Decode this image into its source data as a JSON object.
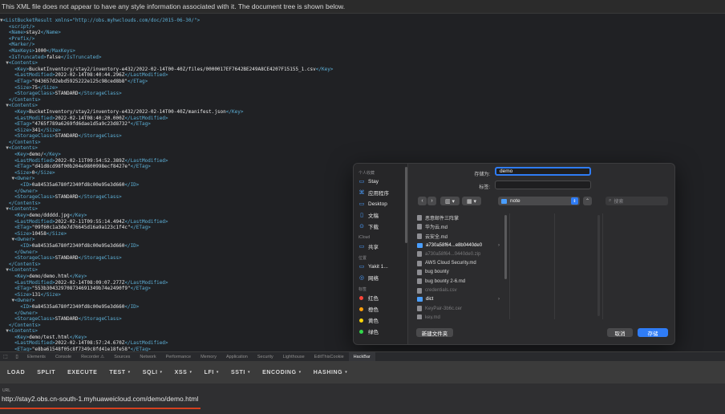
{
  "xml_viewer": {
    "notice": "This XML file does not appear to have any style information associated with it. The document tree is shown below.",
    "lines": [
      {
        "i": 0,
        "a": "▼",
        "t": "<ListBucketResult xmlns=\"http://obs.myhwclouds.com/doc/2015-06-30/\">",
        "k": "tag"
      },
      {
        "i": 1,
        "t": "<script/>",
        "k": "tag"
      },
      {
        "i": 1,
        "t": "<Name>stay2</Name>",
        "k": "mixed"
      },
      {
        "i": 1,
        "t": "<Prefix/>",
        "k": "tag"
      },
      {
        "i": 1,
        "t": "<Marker/>",
        "k": "tag"
      },
      {
        "i": 1,
        "t": "<MaxKeys>1000</MaxKeys>",
        "k": "mixed"
      },
      {
        "i": 1,
        "t": "<IsTruncated>false</IsTruncated>",
        "k": "mixed"
      },
      {
        "i": 1,
        "a": "▼",
        "t": "<Contents>",
        "k": "tag"
      },
      {
        "i": 2,
        "t": "<Key>BucketInventory/stay2/inventory-e432/2022-02-14T00-40Z/files/0000017EF7642BE249A8CE4207F15155_1.csv</Key>",
        "k": "mixed"
      },
      {
        "i": 2,
        "t": "<LastModified>2022-02-14T08:40:44.296Z</LastModified>",
        "k": "mixed"
      },
      {
        "i": 2,
        "t": "<ETag>\"043657d2ebd5925222e125c98ced8b8\"</ETag>",
        "k": "mixed"
      },
      {
        "i": 2,
        "t": "<Size>75</Size>",
        "k": "mixed"
      },
      {
        "i": 2,
        "t": "<StorageClass>STANDARD</StorageClass>",
        "k": "mixed"
      },
      {
        "i": 1,
        "t": "</Contents>",
        "k": "tag"
      },
      {
        "i": 1,
        "a": "▼",
        "t": "<Contents>",
        "k": "tag"
      },
      {
        "i": 2,
        "t": "<Key>BucketInventory/stay2/inventory-e432/2022-02-14T00-40Z/manifest.json</Key>",
        "k": "mixed"
      },
      {
        "i": 2,
        "t": "<LastModified>2022-02-14T08:40:20.000Z</LastModified>",
        "k": "mixed"
      },
      {
        "i": 2,
        "t": "<ETag>\"4765f789a6269fd6dae1d5a9c23d8732\"</ETag>",
        "k": "mixed"
      },
      {
        "i": 2,
        "t": "<Size>341</Size>",
        "k": "mixed"
      },
      {
        "i": 2,
        "t": "<StorageClass>STANDARD</StorageClass>",
        "k": "mixed"
      },
      {
        "i": 1,
        "t": "</Contents>",
        "k": "tag"
      },
      {
        "i": 1,
        "a": "▼",
        "t": "<Contents>",
        "k": "tag"
      },
      {
        "i": 2,
        "t": "<Key>demo/</Key>",
        "k": "mixed"
      },
      {
        "i": 2,
        "t": "<LastModified>2022-02-11T09:54:52.389Z</LastModified>",
        "k": "mixed"
      },
      {
        "i": 2,
        "t": "<ETag>\"d41d8cd98f00b204e9800998ecf8427e\"</ETag>",
        "k": "mixed"
      },
      {
        "i": 2,
        "t": "<Size>0</Size>",
        "k": "mixed"
      },
      {
        "i": 2,
        "a": "▼",
        "t": "<Owner>",
        "k": "tag"
      },
      {
        "i": 3,
        "t": "<ID>0a84535a6780f2340fd8c00e95e3d660</ID>",
        "k": "mixed"
      },
      {
        "i": 2,
        "t": "</Owner>",
        "k": "tag"
      },
      {
        "i": 2,
        "t": "<StorageClass>STANDARD</StorageClass>",
        "k": "mixed"
      },
      {
        "i": 1,
        "t": "</Contents>",
        "k": "tag"
      },
      {
        "i": 1,
        "a": "▼",
        "t": "<Contents>",
        "k": "tag"
      },
      {
        "i": 2,
        "t": "<Key>demo/ddddd.jpg</Key>",
        "k": "mixed"
      },
      {
        "i": 2,
        "t": "<LastModified>2022-02-11T09:55:14.494Z</LastModified>",
        "k": "mixed"
      },
      {
        "i": 2,
        "t": "<ETag>\"09f60c1a3de7d76645d16a9a123c1f4c\"</ETag>",
        "k": "mixed"
      },
      {
        "i": 2,
        "t": "<Size>10458</Size>",
        "k": "mixed"
      },
      {
        "i": 2,
        "a": "▼",
        "t": "<Owner>",
        "k": "tag"
      },
      {
        "i": 3,
        "t": "<ID>0a84535a6780f2340fd8c00e95e3d660</ID>",
        "k": "mixed"
      },
      {
        "i": 2,
        "t": "</Owner>",
        "k": "tag"
      },
      {
        "i": 2,
        "t": "<StorageClass>STANDARD</StorageClass>",
        "k": "mixed"
      },
      {
        "i": 1,
        "t": "</Contents>",
        "k": "tag"
      },
      {
        "i": 1,
        "a": "▼",
        "t": "<Contents>",
        "k": "tag"
      },
      {
        "i": 2,
        "t": "<Key>demo/demo.html</Key>",
        "k": "mixed"
      },
      {
        "i": 2,
        "t": "<LastModified>2022-02-14T08:09:07.277Z</LastModified>",
        "k": "mixed"
      },
      {
        "i": 2,
        "t": "<ETag>\"553b304329708734691349b74e2490f9\"</ETag>",
        "k": "mixed"
      },
      {
        "i": 2,
        "t": "<Size>131</Size>",
        "k": "mixed"
      },
      {
        "i": 2,
        "a": "▼",
        "t": "<Owner>",
        "k": "tag"
      },
      {
        "i": 3,
        "t": "<ID>0a84535a6780f2340fd8c00e95e3d660</ID>",
        "k": "mixed"
      },
      {
        "i": 2,
        "t": "</Owner>",
        "k": "tag"
      },
      {
        "i": 2,
        "t": "<StorageClass>STANDARD</StorageClass>",
        "k": "mixed"
      },
      {
        "i": 1,
        "t": "</Contents>",
        "k": "tag"
      },
      {
        "i": 1,
        "a": "▼",
        "t": "<Contents>",
        "k": "tag"
      },
      {
        "i": 2,
        "t": "<Key>demo/test.html</Key>",
        "k": "mixed"
      },
      {
        "i": 2,
        "t": "<LastModified>2022-02-14T08:57:24.670Z</LastModified>",
        "k": "mixed"
      },
      {
        "i": 2,
        "t": "<ETag>\"e8ba61548f05c8f7349c8fd41e18fe58\"</ETag>",
        "k": "mixed"
      }
    ]
  },
  "save_dialog": {
    "save_as_label": "存储为:",
    "save_as_value": "demo",
    "tags_label": "标签:",
    "tags_value": "",
    "location": "note",
    "search_placeholder": "搜索",
    "sidebar": {
      "favorites_header": "个人收藏",
      "favorites": [
        {
          "label": "Stay",
          "icon": "folder-icon"
        },
        {
          "label": "应用程序",
          "icon": "applications-icon"
        },
        {
          "label": "Desktop",
          "icon": "desktop-icon"
        },
        {
          "label": "文稿",
          "icon": "document-icon"
        },
        {
          "label": "下载",
          "icon": "download-icon"
        }
      ],
      "icloud_header": "iCloud",
      "icloud": [
        {
          "label": "共享",
          "icon": "shared-folder-icon"
        }
      ],
      "locations_header": "位置",
      "locations": [
        {
          "label": "Yakit 1...",
          "icon": "disk-icon"
        },
        {
          "label": "网络",
          "icon": "network-icon"
        }
      ],
      "tags_header": "标签",
      "tags": [
        {
          "label": "红色",
          "color": "#ff453a"
        },
        {
          "label": "橙色",
          "color": "#ff9f0a"
        },
        {
          "label": "黄色",
          "color": "#ffd60a"
        },
        {
          "label": "绿色",
          "color": "#32d74b"
        }
      ]
    },
    "files": [
      {
        "name": "恶意邮件三阵掌",
        "type": "file",
        "dim": false
      },
      {
        "name": "华为云.md",
        "type": "file",
        "dim": false
      },
      {
        "name": "云安全.md",
        "type": "file",
        "dim": false
      },
      {
        "name": "a730a58f64...e8b0440de0",
        "type": "folder",
        "dim": false,
        "sel": true,
        "chevron": true
      },
      {
        "name": "a730a58f64...0440de0.zip",
        "type": "file",
        "dim": true
      },
      {
        "name": "AWS Cloud Security.md",
        "type": "file",
        "dim": false
      },
      {
        "name": "bug bounty",
        "type": "file",
        "dim": false
      },
      {
        "name": "bug bounty 2-6.md",
        "type": "file",
        "dim": false
      },
      {
        "name": "credentials.csv",
        "type": "file",
        "dim": true
      },
      {
        "name": "dict",
        "type": "folder",
        "dim": false,
        "sel": true,
        "chevron": true
      },
      {
        "name": "KeyPair-3b6c.cer",
        "type": "file",
        "dim": true
      },
      {
        "name": "key.md",
        "type": "file",
        "dim": true
      }
    ],
    "new_folder_label": "新建文件夹",
    "cancel_label": "取消",
    "save_label": "存储",
    "accent_color": "#2f7cf6"
  },
  "devtools": {
    "tabs": [
      "Elements",
      "Console",
      "Recorder ⚠",
      "Sources",
      "Network",
      "Performance",
      "Memory",
      "Application",
      "Security",
      "Lighthouse",
      "EditThisCookie",
      "HackBar"
    ],
    "active_tab": "HackBar"
  },
  "hackbar": {
    "buttons": [
      {
        "label": "LOAD",
        "dropdown": false
      },
      {
        "label": "SPLIT",
        "dropdown": false
      },
      {
        "label": "EXECUTE",
        "dropdown": false
      },
      {
        "label": "TEST",
        "dropdown": true
      },
      {
        "label": "SQLI",
        "dropdown": true
      },
      {
        "label": "XSS",
        "dropdown": true
      },
      {
        "label": "LFI",
        "dropdown": true
      },
      {
        "label": "SSTI",
        "dropdown": true
      },
      {
        "label": "ENCODING",
        "dropdown": true
      },
      {
        "label": "HASHING",
        "dropdown": true
      }
    ],
    "url_label": "URL",
    "url_value": "http://stay2.obs.cn-south-1.myhuaweicloud.com/demo/demo.html"
  }
}
